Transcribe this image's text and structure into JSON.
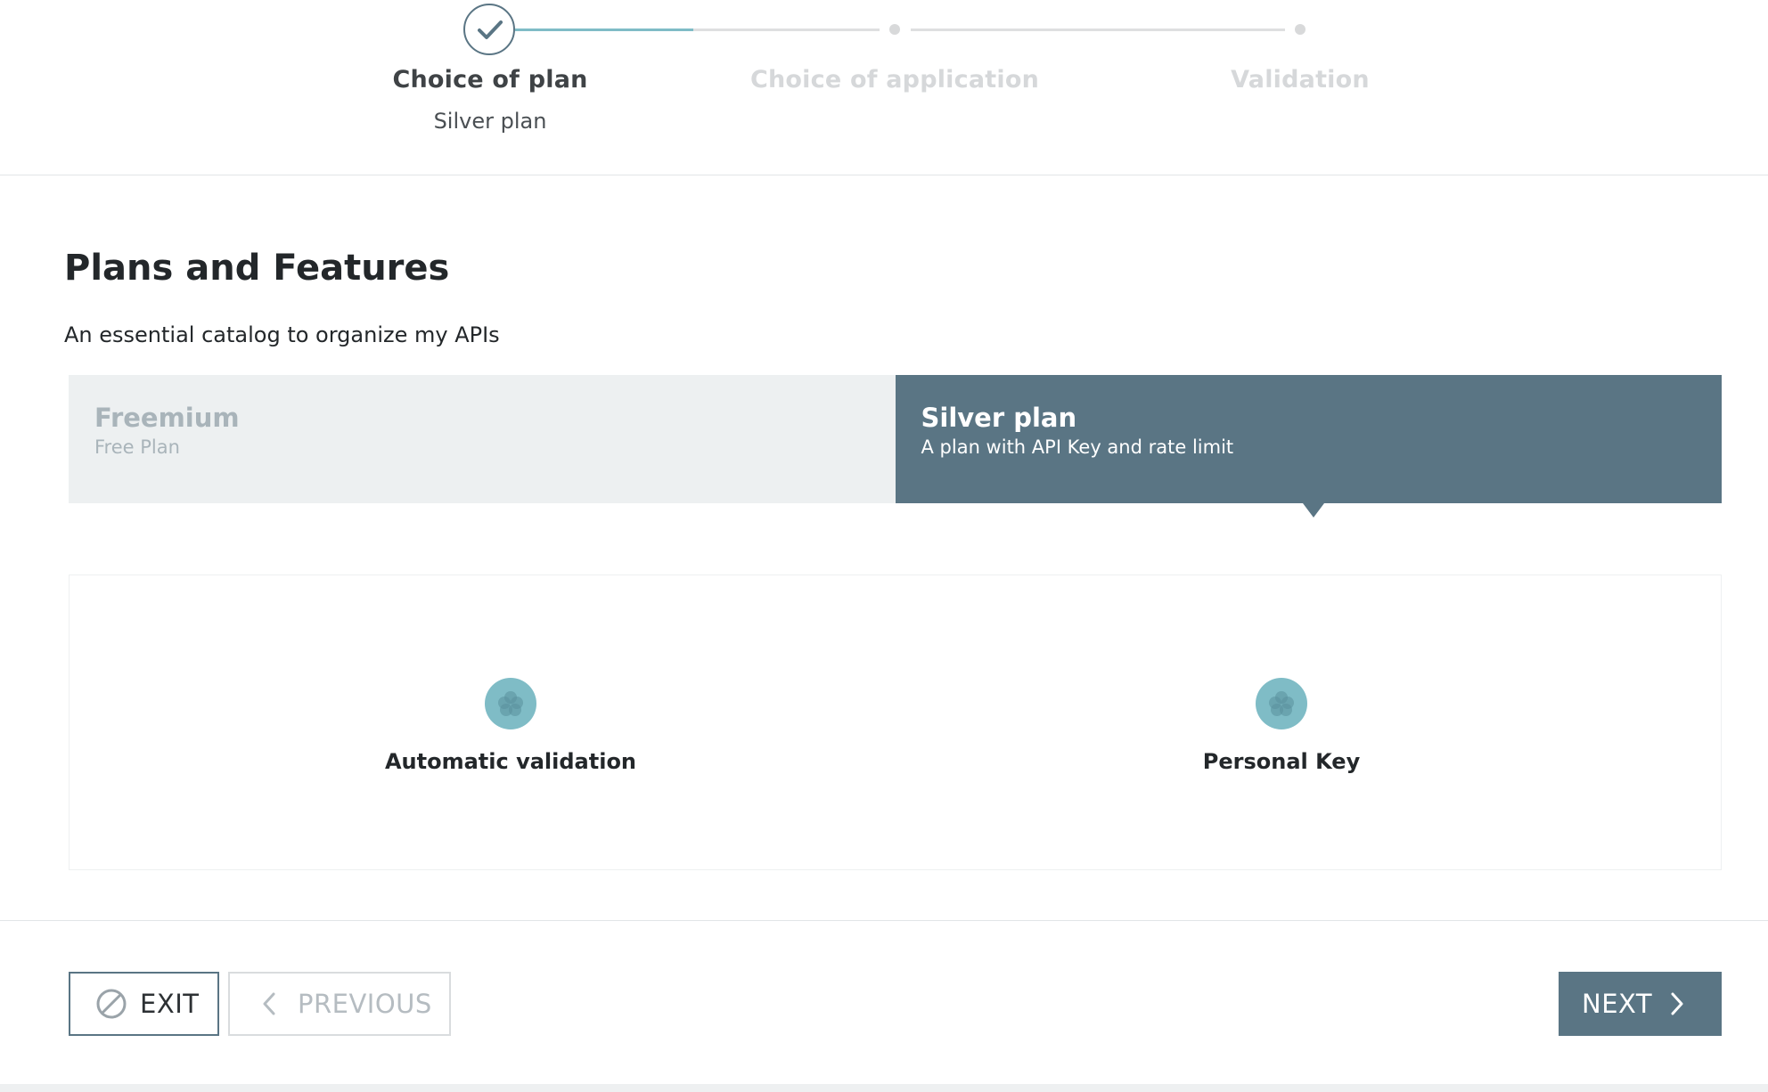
{
  "stepper": {
    "current_step": 1,
    "steps": [
      {
        "title": "Choice of plan",
        "subtitle": "Silver plan",
        "state": "completed"
      },
      {
        "title": "Choice of application",
        "subtitle": "",
        "state": "upcoming"
      },
      {
        "title": "Validation",
        "subtitle": "",
        "state": "upcoming"
      }
    ]
  },
  "page": {
    "title": "Plans and Features",
    "subtitle": "An essential catalog to organize my APIs"
  },
  "plans": [
    {
      "name": "Freemium",
      "description": "Free Plan",
      "selected": false
    },
    {
      "name": "Silver plan",
      "description": "A plan with API Key and rate limit",
      "selected": true
    }
  ],
  "features": [
    {
      "label": "Automatic validation",
      "icon": "flower-icon"
    },
    {
      "label": "Personal Key",
      "icon": "flower-icon"
    }
  ],
  "footer": {
    "exit_label": "EXIT",
    "previous_label": "PREVIOUS",
    "next_label": "NEXT"
  },
  "colors": {
    "primary": "#5a7584",
    "accent": "#7fbcc6",
    "inactive_card": "#edf0f1"
  }
}
